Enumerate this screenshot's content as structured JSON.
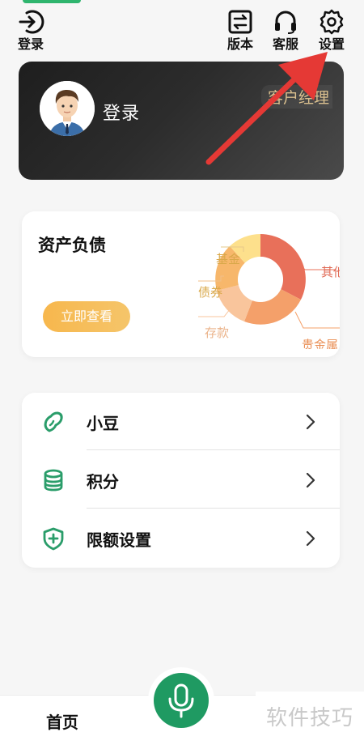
{
  "top_nav": {
    "login_label": "登录",
    "version_label": "版本",
    "service_label": "客服",
    "settings_label": "设置"
  },
  "account_card": {
    "login_text": "登录",
    "manager_badge": "客户经理"
  },
  "assets_card": {
    "title": "资产负债",
    "button_label": "立即查看",
    "legend": {
      "fund": "基金",
      "other": "其他",
      "bond": "债券",
      "deposit": "存款",
      "precious_metal": "贵金属"
    }
  },
  "menu": {
    "items": [
      {
        "label": "小豆",
        "icon": "bean-icon"
      },
      {
        "label": "积分",
        "icon": "database-icon"
      },
      {
        "label": "限额设置",
        "icon": "shield-plus-icon"
      }
    ]
  },
  "bottom_nav": {
    "home_label": "首页",
    "voice_icon": "microphone-icon"
  },
  "watermark": "软件技巧",
  "colors": {
    "brand_green": "#1f9a62",
    "gold": "#d9bf8e",
    "button_orange": "#f7b74d",
    "arrow_red": "#e53935"
  }
}
